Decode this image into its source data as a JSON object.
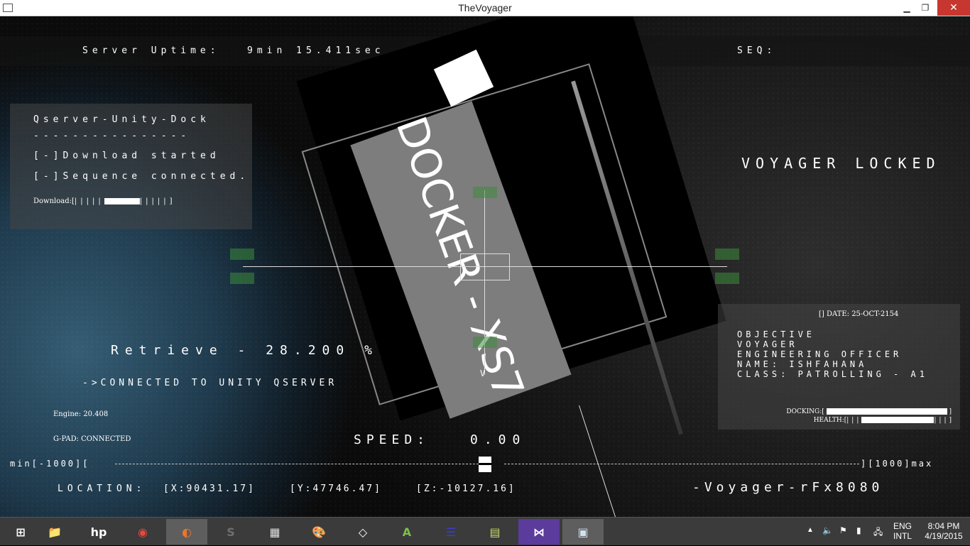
{
  "window": {
    "title": "TheVoyager",
    "minimize": "▁",
    "restore": "❐",
    "close": "✕"
  },
  "hud": {
    "uptime_label": "Server Uptime:",
    "uptime_value": "9min 15.411sec",
    "seq_label": "SEQ:",
    "dock_panel": {
      "title": "Qserver-Unity-Dock",
      "divider": "----------------",
      "line1": "[-]Download started",
      "line2": "[-]Sequence connected.",
      "download_label": "Download:",
      "download_progress": 0.45
    },
    "locked": "VOYAGER LOCKED",
    "retrieve": "Retrieve - 28.200 %",
    "connected": "->CONNECTED TO UNITY QSERVER",
    "engine": "Engine: 20.408",
    "gpad": "G-PAD: CONNECTED",
    "speed_label": "SPEED:",
    "speed_value": "0.00",
    "speed_min": "min[-1000][",
    "speed_max": "][1000]max",
    "location_label": "LOCATION:",
    "loc_x": "[X:90431.17]",
    "loc_y": "[Y:47746.47]",
    "loc_z": "[Z:-10127.16]",
    "signature": "-Voyager-rFx8080",
    "docker_label": "DOCKER - XS7",
    "reticle_v": "V",
    "info_panel": {
      "date": "[] DATE: 25-OCT-2154",
      "objective": "OBJECTIVE",
      "voyager": "VOYAGER",
      "role": "ENGINEERING OFFICER",
      "name": "NAME: ISHFAHANA",
      "class": "CLASS: PATROLLING - A1",
      "docking_label": "DOCKING:",
      "docking_progress": 1.0,
      "health_label": "HEALTH:",
      "health_progress": 0.6
    }
  },
  "taskbar": {
    "items": [
      {
        "name": "windows-start-icon",
        "glyph": "⊞"
      },
      {
        "name": "file-explorer-icon",
        "glyph": "📁"
      },
      {
        "name": "hp-icon",
        "glyph": "hp"
      },
      {
        "name": "chrome-icon",
        "glyph": "◉"
      },
      {
        "name": "firefox-icon",
        "glyph": "◐"
      },
      {
        "name": "sublime-text-icon",
        "glyph": "S"
      },
      {
        "name": "apps-grid-icon",
        "glyph": "▦"
      },
      {
        "name": "paint-icon",
        "glyph": "🎨"
      },
      {
        "name": "unity-icon",
        "glyph": "◇"
      },
      {
        "name": "android-studio-icon",
        "glyph": "A"
      },
      {
        "name": "eclipse-icon",
        "glyph": "☰"
      },
      {
        "name": "notes-icon",
        "glyph": "▤"
      },
      {
        "name": "visual-studio-icon",
        "glyph": "⋈"
      },
      {
        "name": "voyager-app-icon",
        "glyph": "▣"
      }
    ],
    "lang_top": "ENG",
    "lang_bottom": "INTL",
    "time": "8:04 PM",
    "date": "4/19/2015"
  }
}
